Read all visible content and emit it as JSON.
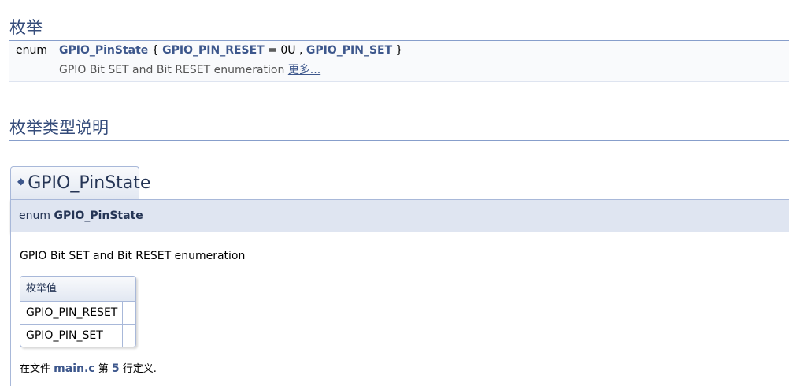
{
  "sections": {
    "enums_title": "枚举",
    "enum_doc_title": "枚举类型说明"
  },
  "summary": {
    "keyword": "enum",
    "name": "GPIO_PinState",
    "open_brace": "{",
    "value1": "GPIO_PIN_RESET",
    "assign": "= 0U ,",
    "value2": "GPIO_PIN_SET",
    "close_brace": "}",
    "brief": "GPIO Bit SET and Bit RESET enumeration",
    "more": "更多..."
  },
  "member": {
    "permalink_glyph": "◆",
    "title": "GPIO_PinState",
    "proto_keyword": "enum",
    "proto_name": "GPIO_PinState",
    "description": "GPIO Bit SET and Bit RESET enumeration",
    "field_table": {
      "header": "枚举值",
      "rows": [
        "GPIO_PIN_RESET",
        "GPIO_PIN_SET"
      ]
    },
    "definition": {
      "prefix": "在文件",
      "file": "main.c",
      "middle": "第",
      "line": "5",
      "suffix": "行定义."
    }
  }
}
